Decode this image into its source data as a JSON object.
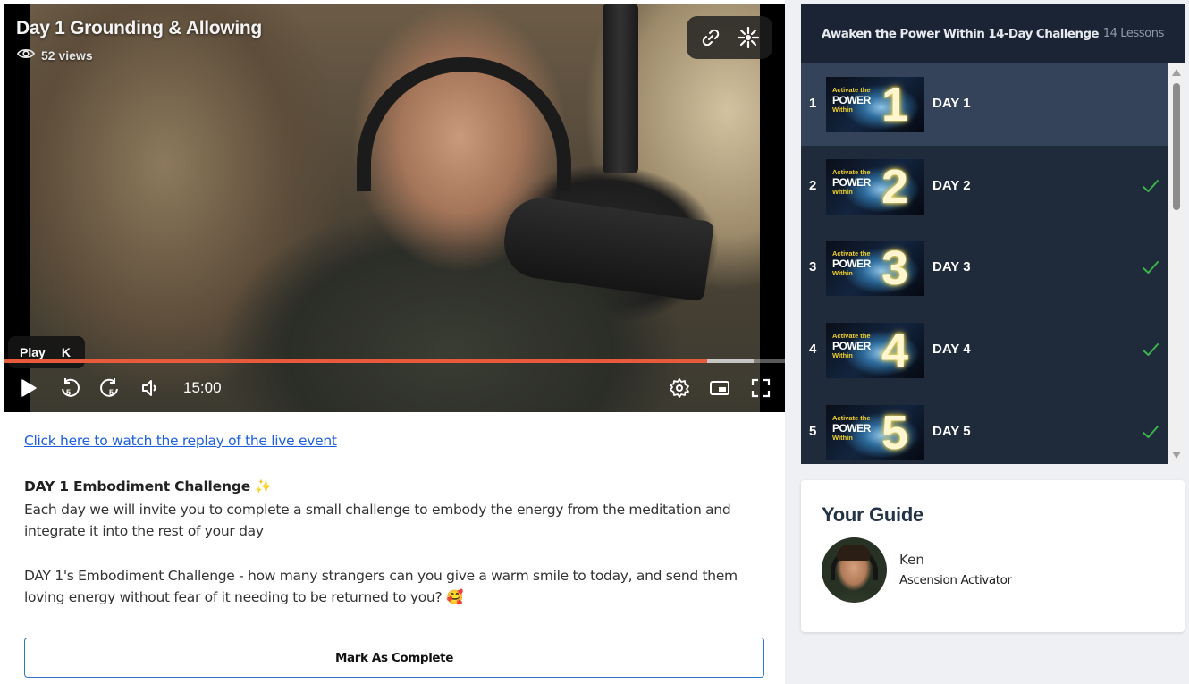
{
  "video": {
    "title": "Day 1 Grounding & Allowing",
    "views": "52 views",
    "tooltip_label": "Play",
    "tooltip_key": "K",
    "time": "15:00",
    "progress_played": 0.901,
    "progress_buffered": 0.96,
    "accent_color": "#e85a3c",
    "icons": [
      "eye-icon",
      "link-icon",
      "sparkle-icon",
      "play-icon",
      "rewind-5-icon",
      "forward-5-icon",
      "volume-icon",
      "settings-icon",
      "pip-icon",
      "fullscreen-icon"
    ]
  },
  "content": {
    "replay_link": "Click here to watch the replay of the live event",
    "challenge_title": "DAY 1 Embodiment Challenge ✨",
    "paragraph1": "Each day we will invite you to complete a small challenge to embody the energy from the meditation and integrate it into the rest of your day",
    "paragraph2": "DAY 1's Embodiment Challenge - how many strangers can you give a warm smile to today, and send them loving energy without fear of it needing to be returned to you? 🥰",
    "complete_button": "Mark As Complete"
  },
  "course": {
    "title": "Awaken the Power Within 14-Day Challenge",
    "lesson_count": "14 Lessons",
    "thumbnail_line1": "Activate the",
    "thumbnail_line2": "POWER",
    "thumbnail_line3": "Within",
    "lessons": [
      {
        "number": "1",
        "thumb_number": "1",
        "label": "DAY 1",
        "completed": false,
        "active": true
      },
      {
        "number": "2",
        "thumb_number": "2",
        "label": "DAY 2",
        "completed": true,
        "active": false
      },
      {
        "number": "3",
        "thumb_number": "3",
        "label": "DAY 3",
        "completed": true,
        "active": false
      },
      {
        "number": "4",
        "thumb_number": "4",
        "label": "DAY 4",
        "completed": true,
        "active": false
      },
      {
        "number": "5",
        "thumb_number": "5",
        "label": "DAY 5",
        "completed": true,
        "active": false
      }
    ],
    "check_color": "#3bb54a"
  },
  "guide": {
    "heading": "Your Guide",
    "name": "Ken",
    "role": "Ascension Activator"
  }
}
